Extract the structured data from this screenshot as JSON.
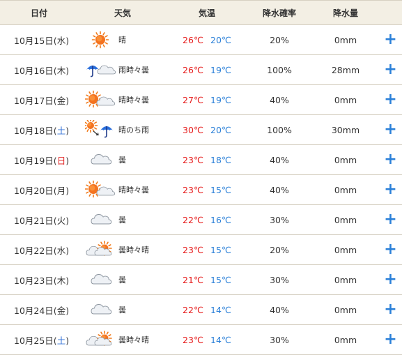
{
  "headers": [
    "日付",
    "天気",
    "気温",
    "降水確率",
    "降水量"
  ],
  "rows": [
    {
      "prefix": "10月15日(",
      "dow": "水",
      "dowType": "weekday",
      "suffix": ")",
      "icon": "sunny",
      "weather": "晴",
      "hi": "26℃",
      "lo": "20℃",
      "pop": "20%",
      "precip": "0mm",
      "plus": "+"
    },
    {
      "prefix": "10月16日(",
      "dow": "木",
      "dowType": "weekday",
      "suffix": ")",
      "icon": "rain-cloudy",
      "weather": "雨時々曇",
      "hi": "26℃",
      "lo": "19℃",
      "pop": "100%",
      "precip": "28mm",
      "plus": "+"
    },
    {
      "prefix": "10月17日(",
      "dow": "金",
      "dowType": "weekday",
      "suffix": ")",
      "icon": "sun-cloud",
      "weather": "晴時々曇",
      "hi": "27℃",
      "lo": "19℃",
      "pop": "40%",
      "precip": "0mm",
      "plus": "+"
    },
    {
      "prefix": "10月18日(",
      "dow": "土",
      "dowType": "sat",
      "suffix": ")",
      "icon": "sun-then-rain",
      "weather": "晴のち雨",
      "hi": "30℃",
      "lo": "20℃",
      "pop": "100%",
      "precip": "30mm",
      "plus": "+"
    },
    {
      "prefix": "10月19日(",
      "dow": "日",
      "dowType": "sun",
      "suffix": ")",
      "icon": "cloudy",
      "weather": "曇",
      "hi": "23℃",
      "lo": "18℃",
      "pop": "40%",
      "precip": "0mm",
      "plus": "+"
    },
    {
      "prefix": "10月20日(",
      "dow": "月",
      "dowType": "weekday",
      "suffix": ")",
      "icon": "sun-cloud",
      "weather": "晴時々曇",
      "hi": "23℃",
      "lo": "15℃",
      "pop": "40%",
      "precip": "0mm",
      "plus": "+"
    },
    {
      "prefix": "10月21日(",
      "dow": "火",
      "dowType": "weekday",
      "suffix": ")",
      "icon": "cloudy",
      "weather": "曇",
      "hi": "22℃",
      "lo": "16℃",
      "pop": "30%",
      "precip": "0mm",
      "plus": "+"
    },
    {
      "prefix": "10月22日(",
      "dow": "水",
      "dowType": "weekday",
      "suffix": ")",
      "icon": "cloud-sun",
      "weather": "曇時々晴",
      "hi": "23℃",
      "lo": "15℃",
      "pop": "20%",
      "precip": "0mm",
      "plus": "+"
    },
    {
      "prefix": "10月23日(",
      "dow": "木",
      "dowType": "weekday",
      "suffix": ")",
      "icon": "cloudy",
      "weather": "曇",
      "hi": "21℃",
      "lo": "15℃",
      "pop": "30%",
      "precip": "0mm",
      "plus": "+"
    },
    {
      "prefix": "10月24日(",
      "dow": "金",
      "dowType": "weekday",
      "suffix": ")",
      "icon": "cloudy",
      "weather": "曇",
      "hi": "22℃",
      "lo": "14℃",
      "pop": "40%",
      "precip": "0mm",
      "plus": "+"
    },
    {
      "prefix": "10月25日(",
      "dow": "土",
      "dowType": "sat",
      "suffix": ")",
      "icon": "cloud-sun",
      "weather": "曇時々晴",
      "hi": "23℃",
      "lo": "14℃",
      "pop": "30%",
      "precip": "0mm",
      "plus": "+"
    }
  ],
  "colors": {
    "high": "#e61b1b",
    "low": "#2b80d8",
    "saturday": "#2f6fd6",
    "sunday": "#e02020",
    "header_bg": "#f3efe4",
    "plus": "#2b80d8"
  }
}
